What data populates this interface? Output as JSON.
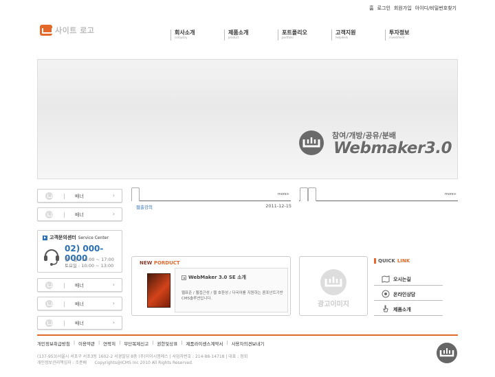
{
  "util_nav": [
    "홈",
    "로그인",
    "회원가입",
    "아이디/비밀번호찾기"
  ],
  "logo": {
    "text": "사이트 로고"
  },
  "gnb": [
    {
      "label": "회사소개",
      "sub": "company"
    },
    {
      "label": "제품소개",
      "sub": "product"
    },
    {
      "label": "포트폴리오",
      "sub": "portfolio"
    },
    {
      "label": "고객지원",
      "sub": "helpdesk"
    },
    {
      "label": "투자정보",
      "sub": "investment"
    }
  ],
  "visual": {
    "slogan": "참여/개방/공유/분배",
    "title": "Webmaker3.0"
  },
  "banners": [
    "배너",
    "배너",
    "배너",
    "배너",
    "배너"
  ],
  "service": {
    "title": "고객문의센터",
    "title_en": "Service Center",
    "phone": "02) 000-0000",
    "hours_weekday": "평　일 : 10:00 ~ 17:00",
    "hours_sat": "토요일 : 10:00 ~ 13:00"
  },
  "board": {
    "more1": "more+",
    "more2": "more+",
    "post_title": "웹출강의",
    "post_date": "2011-12-15"
  },
  "new_product": {
    "header_prefix": "NEW",
    "header_accent": "PORDUCT",
    "title": "WebMaker 3.0 SE 소개",
    "desc": "웹표준 / 웹접근성 / 웹 호환성 / 다국어를 지원하는 콤포넌트기반 CMS솔루션입니다."
  },
  "ad": {
    "label": "광고이미지"
  },
  "quick_link": {
    "title_prefix": "QUICK",
    "title_accent": "LINK",
    "items": [
      "오시는길",
      "온라인상담",
      "제품소개"
    ]
  },
  "footer": {
    "links": [
      "개인정보취급방침",
      "이용약관",
      "연락처",
      "무단복제신고",
      "권한및상표",
      "제품라이센스계약서",
      "사용자의견보내기"
    ],
    "address": "(137-953)서울시 서초구 서초3동 1602-2 서경빌딩 8층 (주)이이시엠에스 | 사업자번호 : 214-88-14718 | 대표 : 정회",
    "manager": "개인정보관리책임자 : 조준배",
    "copyright": "Copyrights@ICMS Inc 2010 All Rights Reserved."
  },
  "colors": {
    "accent": "#e4682a",
    "blue": "#2a6fb5"
  }
}
